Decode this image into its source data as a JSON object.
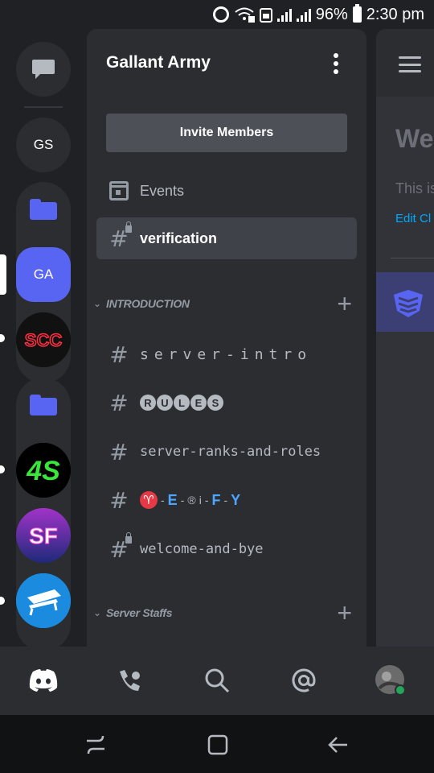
{
  "status": {
    "battery_percent": "96%",
    "time": "2:30 pm"
  },
  "rail": {
    "guilds": [
      {
        "label": "GS"
      },
      {
        "label": "GA"
      }
    ],
    "colors": {
      "accent": "#5865f2",
      "active_guild": "#5865f2"
    }
  },
  "panel": {
    "server_name": "Gallant Army",
    "invite_label": "Invite Members",
    "events_label": "Events",
    "active_channel": "verification",
    "categories": [
      {
        "name": "INTRODUCTION"
      },
      {
        "name": "Server Staffs"
      }
    ],
    "channels": [
      {
        "name": "server-intro"
      },
      {
        "name_letters": [
          "R",
          "U",
          "L",
          "E",
          "S"
        ]
      },
      {
        "name": "server-ranks-and-roles"
      },
      {
        "parts": [
          "♈",
          "-",
          "E",
          "-",
          "®",
          "i",
          "-",
          "F",
          "-",
          "Y"
        ]
      },
      {
        "name": "welcome-and-bye"
      }
    ]
  },
  "main": {
    "welcome_text": "We",
    "this_text": "This is",
    "edit_text": "Edit Cl"
  },
  "icons": {
    "message": "direct-messages-icon",
    "hash": "hash-channel-icon",
    "calendar": "calendar-icon"
  }
}
